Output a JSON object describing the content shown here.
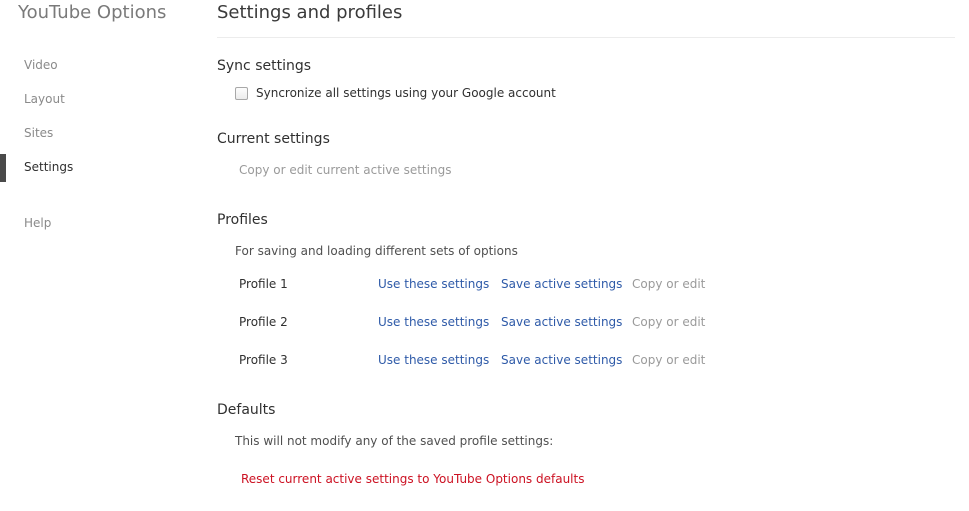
{
  "app": {
    "title": "YouTube Options"
  },
  "sidebar": {
    "items": [
      {
        "label": "Video",
        "active": false
      },
      {
        "label": "Layout",
        "active": false
      },
      {
        "label": "Sites",
        "active": false
      },
      {
        "label": "Settings",
        "active": true
      },
      {
        "label": "Help",
        "active": false
      }
    ]
  },
  "main": {
    "title": "Settings and profiles",
    "sync": {
      "heading": "Sync settings",
      "checkbox_label": "Syncronize all settings using your Google account",
      "checked": false
    },
    "current": {
      "heading": "Current settings",
      "action": "Copy or edit current active settings"
    },
    "profiles": {
      "heading": "Profiles",
      "description": "For saving and loading different sets of options",
      "rows": [
        {
          "name": "Profile 1",
          "use": "Use these settings",
          "save": "Save active settings",
          "copy": "Copy or edit"
        },
        {
          "name": "Profile 2",
          "use": "Use these settings",
          "save": "Save active settings",
          "copy": "Copy or edit"
        },
        {
          "name": "Profile 3",
          "use": "Use these settings",
          "save": "Save active settings",
          "copy": "Copy or edit"
        }
      ]
    },
    "defaults": {
      "heading": "Defaults",
      "description": "This will not modify any of the saved profile settings:",
      "reset_label": "Reset current active settings to YouTube Options defaults"
    }
  },
  "colors": {
    "link": "#2e5aa8",
    "danger": "#cc1122",
    "muted": "#9a9a9a",
    "active_indicator": "#4a4a4a"
  }
}
